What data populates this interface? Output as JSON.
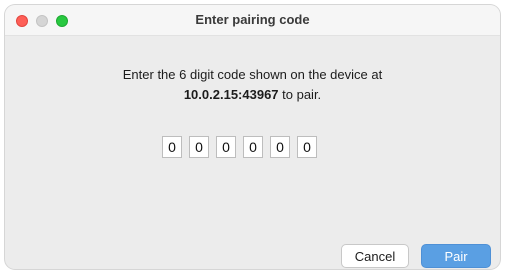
{
  "window": {
    "title": "Enter pairing code"
  },
  "message": {
    "line1": "Enter the 6 digit code shown on the device at",
    "address": "10.0.2.15:43967",
    "suffix": " to pair."
  },
  "code_digits": [
    "0",
    "0",
    "0",
    "0",
    "0",
    "0"
  ],
  "buttons": {
    "cancel_label": "Cancel",
    "pair_label": "Pair"
  },
  "colors": {
    "primary_button": "#5a9fe3",
    "close_light": "#fe5f57",
    "zoom_light": "#28c840"
  }
}
